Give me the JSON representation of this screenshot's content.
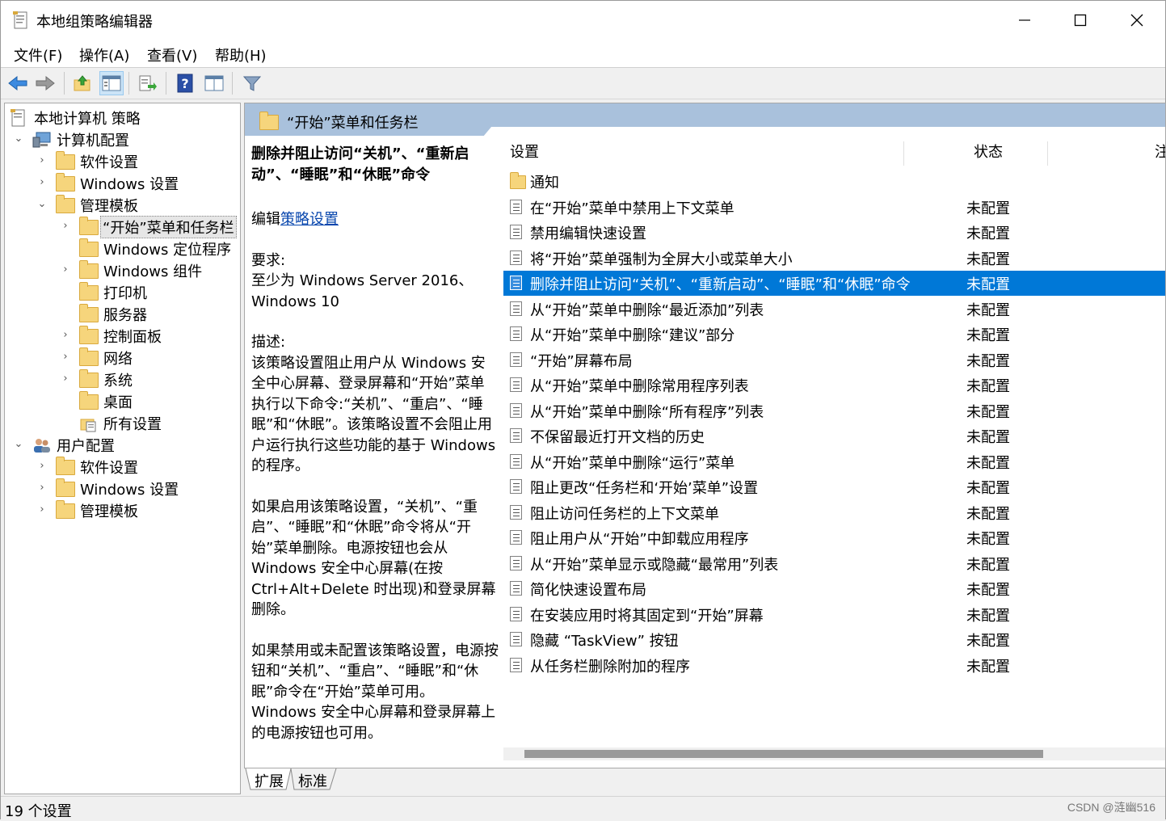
{
  "window": {
    "title": "本地组策略编辑器"
  },
  "menu": [
    "文件(F)",
    "操作(A)",
    "查看(V)",
    "帮助(H)"
  ],
  "toolbar": {
    "icons": [
      "back-arrow-icon",
      "forward-arrow-icon",
      "up-folder-icon",
      "show-hide-tree-icon",
      "export-list-icon",
      "help-icon",
      "properties-icon",
      "filter-icon"
    ]
  },
  "tree": {
    "items": [
      {
        "label": "本地计算机 策略"
      },
      {
        "label": "计算机配置"
      },
      {
        "label": "软件设置"
      },
      {
        "label": "Windows 设置"
      },
      {
        "label": "管理模板"
      },
      {
        "label": "“开始”菜单和任务栏"
      },
      {
        "label": "Windows 定位程序"
      },
      {
        "label": "Windows 组件"
      },
      {
        "label": "打印机"
      },
      {
        "label": "服务器"
      },
      {
        "label": "控制面板"
      },
      {
        "label": "网络"
      },
      {
        "label": "系统"
      },
      {
        "label": "桌面"
      },
      {
        "label": "所有设置"
      },
      {
        "label": "用户配置"
      },
      {
        "label": "软件设置"
      },
      {
        "label": "Windows 设置"
      },
      {
        "label": "管理模板"
      }
    ]
  },
  "pane": {
    "header": "“开始”菜单和任务栏",
    "desc_title": "删除并阻止访问“关机”、“重新启动”、“睡眠”和“休眠”命令",
    "edit_prefix": "编辑",
    "edit_link": "策略设置",
    "req_label": "要求:",
    "req_text": "至少为 Windows Server 2016、Windows 10",
    "desc_label": "描述:",
    "desc_p1": "该策略设置阻止用户从 Windows 安全中心屏幕、登录屏幕和“开始”菜单执行以下命令:“关机”、“重启”、“睡眠”和“休眠”。该策略设置不会阻止用户运行执行这些功能的基于 Windows 的程序。",
    "desc_p2": "如果启用该策略设置，“关机”、“重启”、“睡眠”和“休眠”命令将从“开始”菜单删除。电源按钮也会从 Windows 安全中心屏幕(在按 Ctrl+Alt+Delete 时出现)和登录屏幕删除。",
    "desc_p3": "如果禁用或未配置该策略设置，电源按钮和“关机”、“重启”、“睡眠”和“休眠”命令在“开始”菜单可用。Windows 安全中心屏幕和登录屏幕上的电源按钮也可用。"
  },
  "list": {
    "columns": [
      "设置",
      "状态",
      "注"
    ],
    "rows": [
      {
        "name": "通知",
        "state": "",
        "type": "folder"
      },
      {
        "name": "在“开始”菜单中禁用上下文菜单",
        "state": "未配置"
      },
      {
        "name": "禁用编辑快速设置",
        "state": "未配置"
      },
      {
        "name": "将“开始”菜单强制为全屏大小或菜单大小",
        "state": "未配置"
      },
      {
        "name": "删除并阻止访问“关机”、“重新启动”、“睡眠”和“休眠”命令",
        "state": "未配置",
        "selected": true
      },
      {
        "name": "从“开始”菜单中删除“最近添加”列表",
        "state": "未配置"
      },
      {
        "name": "从“开始”菜单中删除“建议”部分",
        "state": "未配置"
      },
      {
        "name": "“开始”屏幕布局",
        "state": "未配置"
      },
      {
        "name": "从“开始”菜单中删除常用程序列表",
        "state": "未配置"
      },
      {
        "name": "从“开始”菜单中删除“所有程序”列表",
        "state": "未配置"
      },
      {
        "name": "不保留最近打开文档的历史",
        "state": "未配置"
      },
      {
        "name": "从“开始”菜单中删除“运行”菜单",
        "state": "未配置"
      },
      {
        "name": "阻止更改“任务栏和‘开始’菜单”设置",
        "state": "未配置"
      },
      {
        "name": "阻止访问任务栏的上下文菜单",
        "state": "未配置"
      },
      {
        "name": "阻止用户从“开始”中卸载应用程序",
        "state": "未配置"
      },
      {
        "name": "从“开始”菜单显示或隐藏“最常用”列表",
        "state": "未配置"
      },
      {
        "name": "简化快速设置布局",
        "state": "未配置"
      },
      {
        "name": "在安装应用时将其固定到“开始”屏幕",
        "state": "未配置"
      },
      {
        "name": "隐藏 “TaskView” 按钮",
        "state": "未配置"
      },
      {
        "name": "从任务栏删除附加的程序",
        "state": "未配置"
      }
    ]
  },
  "tabs": [
    "扩展",
    "标准"
  ],
  "status": "19 个设置",
  "watermark": "CSDN @涟幽516",
  "colors": {
    "selection": "#0078d7",
    "header": "#a9c1dc",
    "link": "#0645ad"
  }
}
